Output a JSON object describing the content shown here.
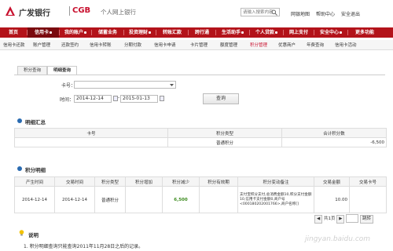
{
  "header": {
    "bank_name": "广发银行",
    "bank_code": "CGB",
    "subtitle": "个人网上银行",
    "search_placeholder": "请输入搜索内容",
    "links": [
      "网银地图",
      "帮助中心",
      "安全退出"
    ]
  },
  "nav": {
    "items": [
      {
        "label": "首页",
        "active": false
      },
      {
        "label": "信用卡",
        "active": true
      },
      {
        "label": "我的账户",
        "active": false
      },
      {
        "label": "储蓄业务",
        "active": false
      },
      {
        "label": "投资理财",
        "active": false
      },
      {
        "label": "转账汇款",
        "active": false
      },
      {
        "label": "跨行通",
        "active": false
      },
      {
        "label": "生活助手",
        "active": false
      },
      {
        "label": "个人贷款",
        "active": false
      },
      {
        "label": "网上支付",
        "active": false
      },
      {
        "label": "安全中心",
        "active": false
      },
      {
        "label": "更多功能",
        "active": false
      }
    ]
  },
  "subnav": {
    "items": [
      {
        "label": "信用卡还款",
        "active": false
      },
      {
        "label": "账户管理",
        "active": false
      },
      {
        "label": "还款签约",
        "active": false
      },
      {
        "label": "信用卡转账",
        "active": false
      },
      {
        "label": "分期付款",
        "active": false
      },
      {
        "label": "信用卡申请",
        "active": false
      },
      {
        "label": "卡片管理",
        "active": false
      },
      {
        "label": "额度管理",
        "active": false
      },
      {
        "label": "积分管理",
        "active": true
      },
      {
        "label": "优惠商户",
        "active": false
      },
      {
        "label": "年费查询",
        "active": false
      },
      {
        "label": "信用卡活动",
        "active": false
      }
    ]
  },
  "tabs": [
    {
      "label": "积分查询",
      "active": false
    },
    {
      "label": "明细查询",
      "active": true
    }
  ],
  "form": {
    "card_label": "卡号：",
    "card_value": "",
    "time_label": "时间：",
    "date_from": "2014-12-14",
    "date_to": "2015-01-13",
    "query_button": "查询"
  },
  "summary": {
    "title": "明细汇总",
    "columns": [
      "卡号",
      "积分类型",
      "合计积分数"
    ],
    "rows": [
      [
        "",
        "普通积分",
        "-6,500"
      ]
    ]
  },
  "detail": {
    "title": "积分明细",
    "columns": [
      "产生时间",
      "交易时间",
      "积分类型",
      "积分增加",
      "积分减少",
      "积分有效期",
      "积分变动备注",
      "交易金额",
      "交易卡号"
    ],
    "rows": [
      {
        "produce_time": "2014-12-14",
        "trade_time": "2014-12-14",
        "type": "普通积分",
        "increase": "",
        "decrease": "6,500",
        "expiry": "",
        "remark": "支付宝积分支付,总消费金额10,积分支付金额10,信用卡支付金额0,商户号<000180202001766>,商户名称[]",
        "amount": "10.00",
        "card_no": ""
      }
    ]
  },
  "pager": {
    "text": "共1页",
    "go_label": "跳转"
  },
  "notes": {
    "title": "说明",
    "line1": "1. 积分明细查询只能查询2011年11月28日之后的记录。"
  },
  "watermark": "jingyan.baidu.com",
  "colors": {
    "brand_red": "#c8102e",
    "nav_red": "#b3131a",
    "section_blue": "#2a6bb1"
  }
}
